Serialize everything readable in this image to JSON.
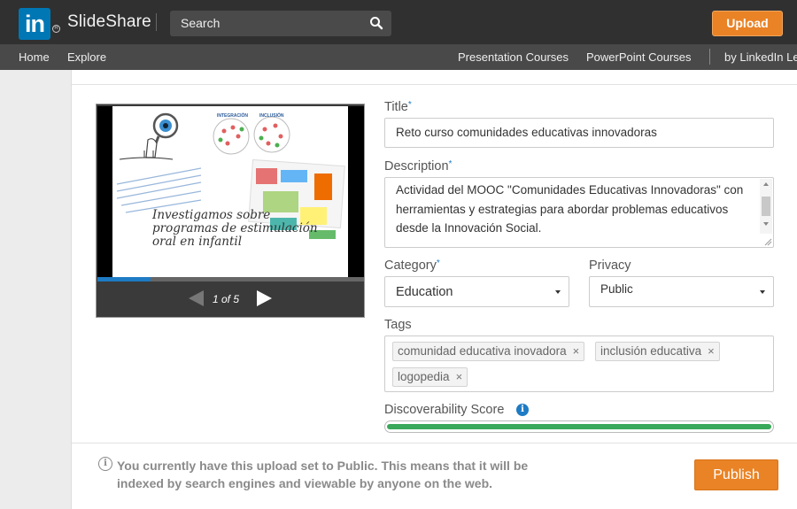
{
  "header": {
    "logo_text": "in",
    "brand": "SlideShare",
    "search_placeholder": "Search",
    "upload_label": "Upload"
  },
  "nav": {
    "home": "Home",
    "explore": "Explore",
    "presentation_courses": "Presentation Courses",
    "powerpoint_courses": "PowerPoint Courses",
    "by_linkedin": "by LinkedIn Le"
  },
  "preview": {
    "slide_label_1": "INTEGRACIÓN",
    "slide_label_2": "INCLUSIÓN",
    "slide_text": "Investigamos sobre programas de estimulación oral en infantil",
    "page_indicator": "1 of 5",
    "progress": 0.2
  },
  "form": {
    "title_label": "Title",
    "title_value": "Reto curso comunidades educativas innovadoras",
    "description_label": "Description",
    "description_value": "Actividad  del MOOC \"Comunidades Educativas Innovadoras\" con herramientas y estrategias para abordar problemas educativos desde la Innovación Social.",
    "category_label": "Category",
    "category_value": "Education",
    "privacy_label": "Privacy",
    "privacy_value": "Public",
    "tags_label": "Tags",
    "tags": [
      "comunidad educativa inovadora",
      "inclusión educativa",
      "logopedia"
    ],
    "discoverability_label": "Discoverability Score",
    "discoverability_score": 1.0,
    "required_marker": "*"
  },
  "footer": {
    "notice": "You currently have this upload set to Public. This means that it will be indexed by search engines and viewable by anyone on the web.",
    "publish_label": "Publish"
  },
  "colors": {
    "accent_orange": "#e98326",
    "linkedin_blue": "#0077b5",
    "score_green": "#3aa85a"
  }
}
